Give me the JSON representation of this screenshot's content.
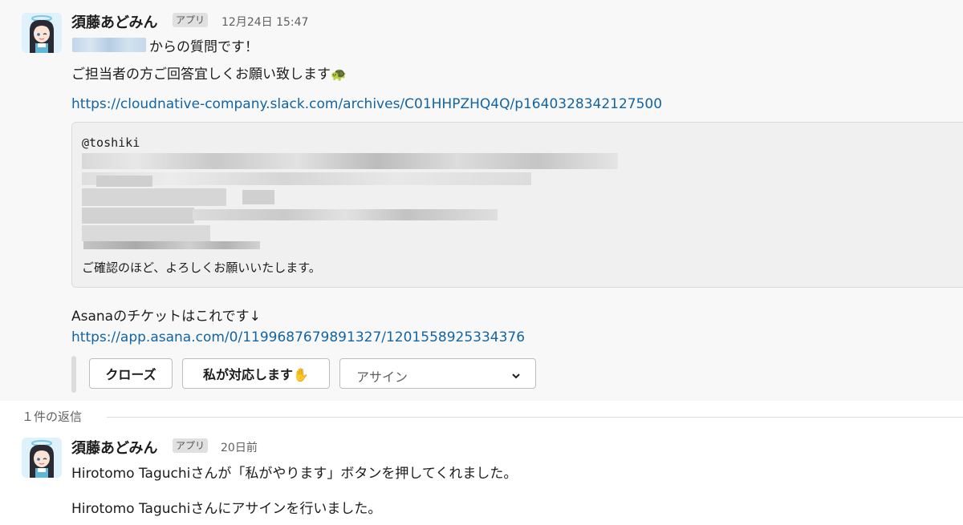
{
  "message": {
    "sender": "須藤あどみん",
    "badge": "アプリ",
    "timestamp": "12月24日 15:47",
    "line1_suffix": "からの質問です！",
    "line2": "ご担当者の方ご回答宜しくお願い致します",
    "line2_emoji": "🐢",
    "slack_link": "https://cloudnative-company.slack.com/archives/C01HHPZHQ4Q/p1640328342127500",
    "quote_mention": "@toshiki",
    "quote_closing": "ご確認のほど、よろしくお願いいたします。",
    "asana_text": "Asanaのチケットはこれです↓",
    "asana_link": "https://app.asana.com/0/1199687679891327/1201558925334376",
    "actions": {
      "close_label": "クローズ",
      "handle_label": "私が対応します✋",
      "assign_placeholder": "アサイン",
      "assign_icon": "chevron-down-icon"
    }
  },
  "thread": {
    "replies_label": "１件の返信",
    "reply": {
      "sender": "須藤あどみん",
      "badge": "アプリ",
      "timestamp": "20日前",
      "line1": "Hirotomo Taguchiさんが「私がやります」ボタンを押してくれました。",
      "line2": "Hirotomo Taguchiさんにアサインを行いました。"
    }
  }
}
